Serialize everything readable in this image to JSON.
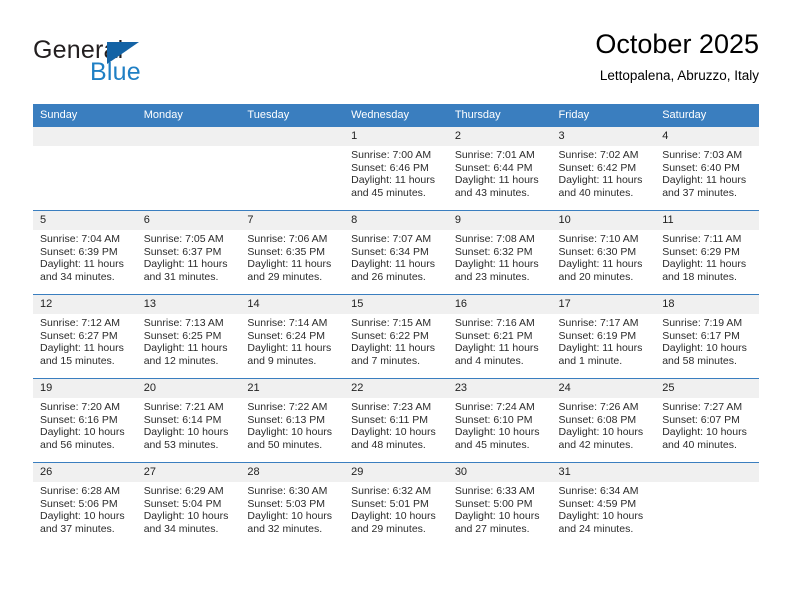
{
  "brand": {
    "word1": "General",
    "word2": "Blue",
    "logo_icon": "triangle-logo-icon",
    "colors": {
      "word1": "#231f20",
      "word2": "#1f7fc4",
      "triangle": "#1463a5"
    }
  },
  "header": {
    "title": "October 2025",
    "subtitle": "Lettopalena, Abruzzo, Italy"
  },
  "theme": {
    "header_bg": "#3a7ebf",
    "header_text": "#ffffff",
    "daynum_bg": "#f0f0f0",
    "grid_line": "#3a7ebf"
  },
  "calendar": {
    "weekday_headers": [
      "Sunday",
      "Monday",
      "Tuesday",
      "Wednesday",
      "Thursday",
      "Friday",
      "Saturday"
    ],
    "weeks": [
      [
        {
          "day": "",
          "empty": true
        },
        {
          "day": "",
          "empty": true
        },
        {
          "day": "",
          "empty": true
        },
        {
          "day": "1",
          "sunrise": "Sunrise: 7:00 AM",
          "sunset": "Sunset: 6:46 PM",
          "daylight_1": "Daylight: 11 hours",
          "daylight_2": "and 45 minutes."
        },
        {
          "day": "2",
          "sunrise": "Sunrise: 7:01 AM",
          "sunset": "Sunset: 6:44 PM",
          "daylight_1": "Daylight: 11 hours",
          "daylight_2": "and 43 minutes."
        },
        {
          "day": "3",
          "sunrise": "Sunrise: 7:02 AM",
          "sunset": "Sunset: 6:42 PM",
          "daylight_1": "Daylight: 11 hours",
          "daylight_2": "and 40 minutes."
        },
        {
          "day": "4",
          "sunrise": "Sunrise: 7:03 AM",
          "sunset": "Sunset: 6:40 PM",
          "daylight_1": "Daylight: 11 hours",
          "daylight_2": "and 37 minutes."
        }
      ],
      [
        {
          "day": "5",
          "sunrise": "Sunrise: 7:04 AM",
          "sunset": "Sunset: 6:39 PM",
          "daylight_1": "Daylight: 11 hours",
          "daylight_2": "and 34 minutes."
        },
        {
          "day": "6",
          "sunrise": "Sunrise: 7:05 AM",
          "sunset": "Sunset: 6:37 PM",
          "daylight_1": "Daylight: 11 hours",
          "daylight_2": "and 31 minutes."
        },
        {
          "day": "7",
          "sunrise": "Sunrise: 7:06 AM",
          "sunset": "Sunset: 6:35 PM",
          "daylight_1": "Daylight: 11 hours",
          "daylight_2": "and 29 minutes."
        },
        {
          "day": "8",
          "sunrise": "Sunrise: 7:07 AM",
          "sunset": "Sunset: 6:34 PM",
          "daylight_1": "Daylight: 11 hours",
          "daylight_2": "and 26 minutes."
        },
        {
          "day": "9",
          "sunrise": "Sunrise: 7:08 AM",
          "sunset": "Sunset: 6:32 PM",
          "daylight_1": "Daylight: 11 hours",
          "daylight_2": "and 23 minutes."
        },
        {
          "day": "10",
          "sunrise": "Sunrise: 7:10 AM",
          "sunset": "Sunset: 6:30 PM",
          "daylight_1": "Daylight: 11 hours",
          "daylight_2": "and 20 minutes."
        },
        {
          "day": "11",
          "sunrise": "Sunrise: 7:11 AM",
          "sunset": "Sunset: 6:29 PM",
          "daylight_1": "Daylight: 11 hours",
          "daylight_2": "and 18 minutes."
        }
      ],
      [
        {
          "day": "12",
          "sunrise": "Sunrise: 7:12 AM",
          "sunset": "Sunset: 6:27 PM",
          "daylight_1": "Daylight: 11 hours",
          "daylight_2": "and 15 minutes."
        },
        {
          "day": "13",
          "sunrise": "Sunrise: 7:13 AM",
          "sunset": "Sunset: 6:25 PM",
          "daylight_1": "Daylight: 11 hours",
          "daylight_2": "and 12 minutes."
        },
        {
          "day": "14",
          "sunrise": "Sunrise: 7:14 AM",
          "sunset": "Sunset: 6:24 PM",
          "daylight_1": "Daylight: 11 hours",
          "daylight_2": "and 9 minutes."
        },
        {
          "day": "15",
          "sunrise": "Sunrise: 7:15 AM",
          "sunset": "Sunset: 6:22 PM",
          "daylight_1": "Daylight: 11 hours",
          "daylight_2": "and 7 minutes."
        },
        {
          "day": "16",
          "sunrise": "Sunrise: 7:16 AM",
          "sunset": "Sunset: 6:21 PM",
          "daylight_1": "Daylight: 11 hours",
          "daylight_2": "and 4 minutes."
        },
        {
          "day": "17",
          "sunrise": "Sunrise: 7:17 AM",
          "sunset": "Sunset: 6:19 PM",
          "daylight_1": "Daylight: 11 hours",
          "daylight_2": "and 1 minute."
        },
        {
          "day": "18",
          "sunrise": "Sunrise: 7:19 AM",
          "sunset": "Sunset: 6:17 PM",
          "daylight_1": "Daylight: 10 hours",
          "daylight_2": "and 58 minutes."
        }
      ],
      [
        {
          "day": "19",
          "sunrise": "Sunrise: 7:20 AM",
          "sunset": "Sunset: 6:16 PM",
          "daylight_1": "Daylight: 10 hours",
          "daylight_2": "and 56 minutes."
        },
        {
          "day": "20",
          "sunrise": "Sunrise: 7:21 AM",
          "sunset": "Sunset: 6:14 PM",
          "daylight_1": "Daylight: 10 hours",
          "daylight_2": "and 53 minutes."
        },
        {
          "day": "21",
          "sunrise": "Sunrise: 7:22 AM",
          "sunset": "Sunset: 6:13 PM",
          "daylight_1": "Daylight: 10 hours",
          "daylight_2": "and 50 minutes."
        },
        {
          "day": "22",
          "sunrise": "Sunrise: 7:23 AM",
          "sunset": "Sunset: 6:11 PM",
          "daylight_1": "Daylight: 10 hours",
          "daylight_2": "and 48 minutes."
        },
        {
          "day": "23",
          "sunrise": "Sunrise: 7:24 AM",
          "sunset": "Sunset: 6:10 PM",
          "daylight_1": "Daylight: 10 hours",
          "daylight_2": "and 45 minutes."
        },
        {
          "day": "24",
          "sunrise": "Sunrise: 7:26 AM",
          "sunset": "Sunset: 6:08 PM",
          "daylight_1": "Daylight: 10 hours",
          "daylight_2": "and 42 minutes."
        },
        {
          "day": "25",
          "sunrise": "Sunrise: 7:27 AM",
          "sunset": "Sunset: 6:07 PM",
          "daylight_1": "Daylight: 10 hours",
          "daylight_2": "and 40 minutes."
        }
      ],
      [
        {
          "day": "26",
          "sunrise": "Sunrise: 6:28 AM",
          "sunset": "Sunset: 5:06 PM",
          "daylight_1": "Daylight: 10 hours",
          "daylight_2": "and 37 minutes."
        },
        {
          "day": "27",
          "sunrise": "Sunrise: 6:29 AM",
          "sunset": "Sunset: 5:04 PM",
          "daylight_1": "Daylight: 10 hours",
          "daylight_2": "and 34 minutes."
        },
        {
          "day": "28",
          "sunrise": "Sunrise: 6:30 AM",
          "sunset": "Sunset: 5:03 PM",
          "daylight_1": "Daylight: 10 hours",
          "daylight_2": "and 32 minutes."
        },
        {
          "day": "29",
          "sunrise": "Sunrise: 6:32 AM",
          "sunset": "Sunset: 5:01 PM",
          "daylight_1": "Daylight: 10 hours",
          "daylight_2": "and 29 minutes."
        },
        {
          "day": "30",
          "sunrise": "Sunrise: 6:33 AM",
          "sunset": "Sunset: 5:00 PM",
          "daylight_1": "Daylight: 10 hours",
          "daylight_2": "and 27 minutes."
        },
        {
          "day": "31",
          "sunrise": "Sunrise: 6:34 AM",
          "sunset": "Sunset: 4:59 PM",
          "daylight_1": "Daylight: 10 hours",
          "daylight_2": "and 24 minutes."
        },
        {
          "day": "",
          "empty": true
        }
      ]
    ]
  }
}
